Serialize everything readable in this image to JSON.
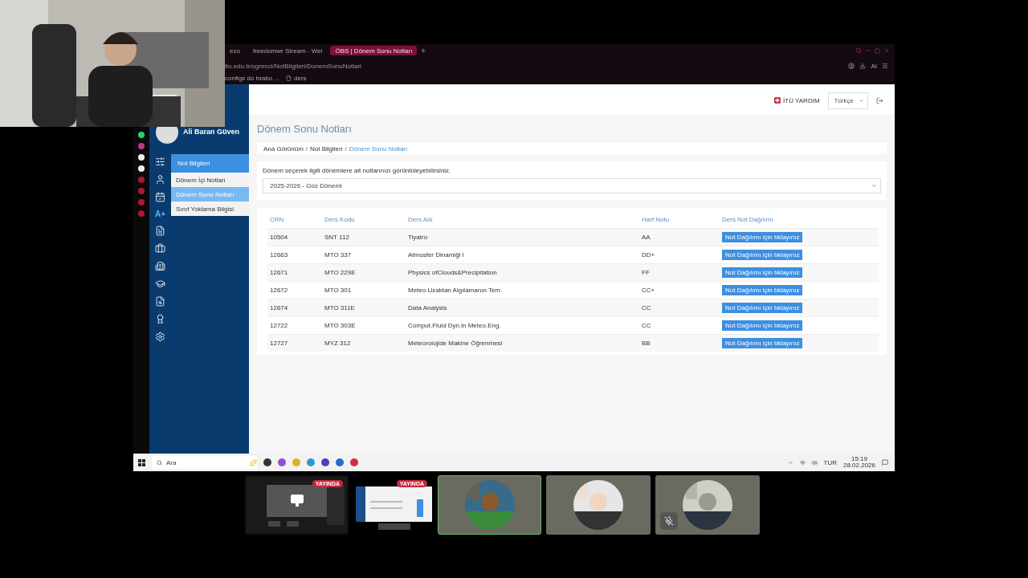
{
  "browser": {
    "tabs": [
      {
        "label": "ezo",
        "selected": false
      },
      {
        "label": "freedomwr Stream - Wei",
        "selected": false
      },
      {
        "label": "ÖBS | Dönem Sonu Notları",
        "selected": true
      }
    ],
    "address": "itu.edu.tr/ogrenci/NotBilgileri/DonemSonuNotlari",
    "bookmarks": [
      "configs do brabo ...",
      "ders"
    ],
    "ai_label": "AI"
  },
  "user": {
    "name": "Ali Baran Güven"
  },
  "menu": {
    "title": "Not Bilgileri",
    "items": [
      {
        "label": "Dönem İçi Notları",
        "selected": false
      },
      {
        "label": "Dönem Sonu Notları",
        "selected": true
      },
      {
        "label": "Sınıf Yoklama Bilgisi",
        "selected": false
      }
    ]
  },
  "rail": {
    "grade_label": "A+"
  },
  "header": {
    "help": "İTÜ YARDIM",
    "language": "Türkçe"
  },
  "page": {
    "title": "Dönem Sonu Notları",
    "breadcrumb_separator": "/",
    "breadcrumb": [
      {
        "label": "Ana Görünüm",
        "current": false
      },
      {
        "label": "Not Bilgileri",
        "current": false
      },
      {
        "label": "Dönem Sonu Notları",
        "current": true
      }
    ],
    "prompt": "Dönem seçerek ilgili dönemlere ait notlarınızı görüntüleyebilirsiniz.",
    "term": "2025-2026 - Güz Dönemi"
  },
  "table": {
    "columns": [
      "CRN",
      "Ders Kodu",
      "Ders Adı",
      "Harf Notu",
      "Ders Not Dağılımı"
    ],
    "rows": [
      {
        "crn": "10504",
        "code": "SNT 112",
        "name": "Tiyatro",
        "grade": "AA",
        "action": "Not Dağılımı için tıklayınız"
      },
      {
        "crn": "12663",
        "code": "MTO 337",
        "name": "Atmosfer Dinamiği I",
        "grade": "DD+",
        "action": "Not Dağılımı için tıklayınız"
      },
      {
        "crn": "12671",
        "code": "MTO 229E",
        "name": "Physics ofClouds&Precipitation",
        "grade": "FF",
        "action": "Not Dağılımı için tıklayınız"
      },
      {
        "crn": "12672",
        "code": "MTO 301",
        "name": "Meteo.Uzaktan Algılamanın Tem.",
        "grade": "CC+",
        "action": "Not Dağılımı için tıklayınız"
      },
      {
        "crn": "12674",
        "code": "MTO 311E",
        "name": "Data Analysis",
        "grade": "CC",
        "action": "Not Dağılımı için tıklayınız"
      },
      {
        "crn": "12722",
        "code": "MTO 303E",
        "name": "Comput.Fluid Dyn.in Meteo.Eng.",
        "grade": "CC",
        "action": "Not Dağılımı için tıklayınız"
      },
      {
        "crn": "12727",
        "code": "MYZ 312",
        "name": "Meteorolojide Makine Öğrenmesi",
        "grade": "BB",
        "action": "Not Dağılımı için tıklayınız"
      }
    ]
  },
  "taskbar": {
    "search": "Ara",
    "language": "TUR",
    "time": "15:19",
    "date": "28.02.2026"
  },
  "participants": [
    {
      "kind": "screen",
      "badge": "YAYINDA",
      "selected": false,
      "muted": false
    },
    {
      "kind": "page",
      "badge": "YAYINDA",
      "selected": false,
      "muted": false
    },
    {
      "kind": "avatar",
      "selected": true,
      "muted": false
    },
    {
      "kind": "avatar",
      "selected": false,
      "muted": false
    },
    {
      "kind": "avatar",
      "selected": false,
      "muted": true
    }
  ]
}
